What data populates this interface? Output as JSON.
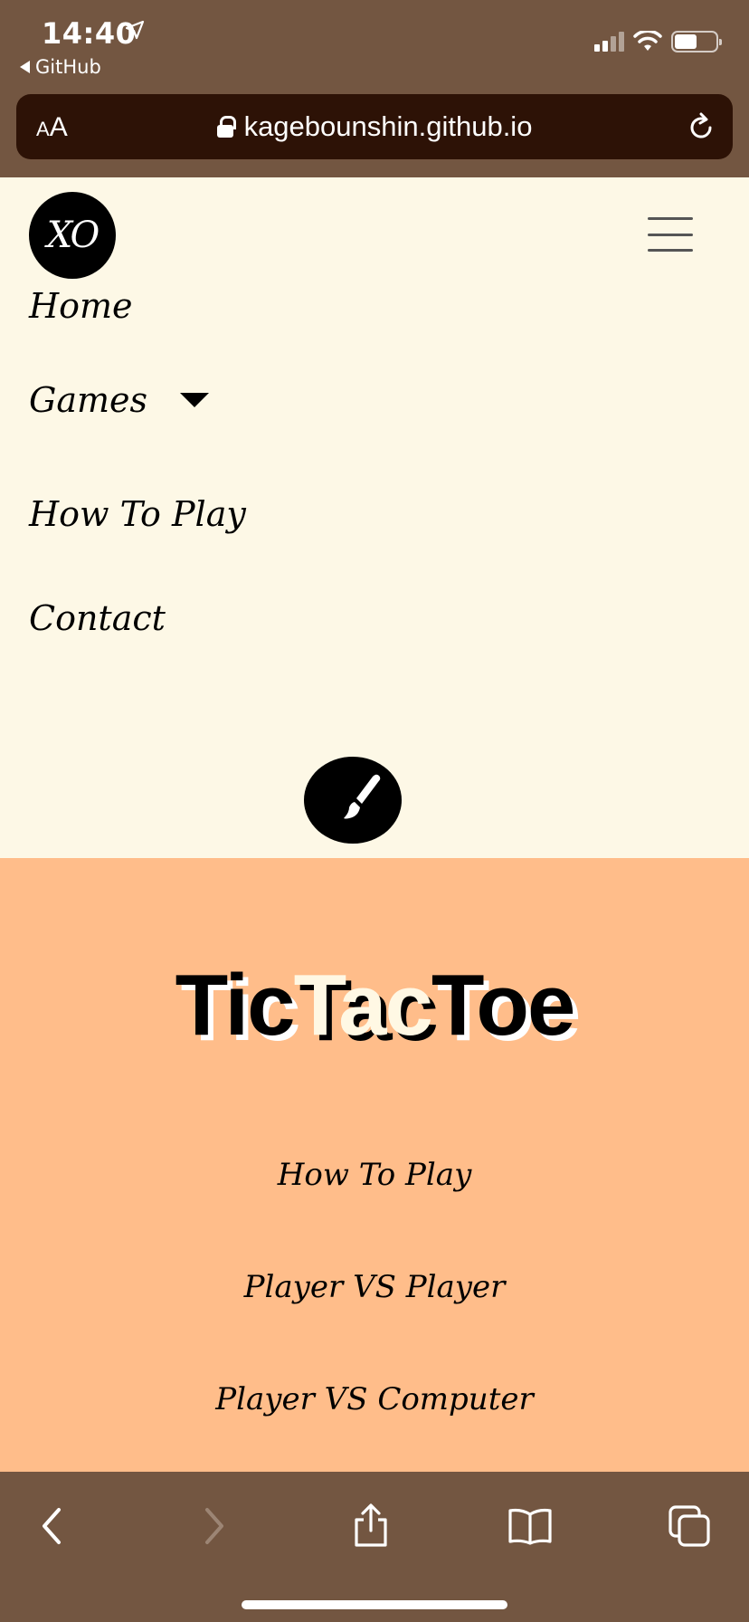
{
  "status": {
    "time": "14:40",
    "back_app": "GitHub"
  },
  "browser": {
    "text_size": {
      "small": "A",
      "big": "A"
    },
    "url": "kagebounshin.github.io"
  },
  "nav": {
    "logo": "XO",
    "items": [
      {
        "label": "Home"
      },
      {
        "label": "Games"
      },
      {
        "label": "How To Play"
      },
      {
        "label": "Contact"
      }
    ]
  },
  "hero": {
    "title_parts": [
      "Tic",
      "Tac",
      "Toe"
    ],
    "links": [
      {
        "label": "How To Play"
      },
      {
        "label": "Player VS Player"
      },
      {
        "label": "Player VS Computer"
      }
    ]
  },
  "colors": {
    "chrome": "#735641",
    "urlbar": "#2d1206",
    "page_bg": "#fdf8e6",
    "hero_bg": "#ffbd8a"
  },
  "icons": [
    "location-arrow-icon",
    "signal-icon",
    "wifi-icon",
    "battery-icon",
    "lock-icon",
    "reload-icon",
    "menu-icon",
    "dropdown-caret-icon",
    "paintbrush-icon",
    "back-icon",
    "forward-icon",
    "share-icon",
    "bookmarks-icon",
    "tabs-icon"
  ]
}
